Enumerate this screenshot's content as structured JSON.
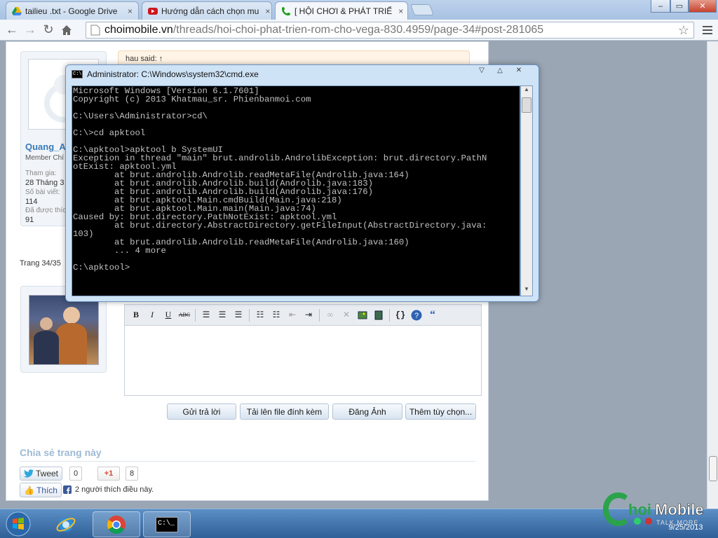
{
  "browser": {
    "tabs": [
      {
        "title": "tailieu .txt - Google Drive",
        "icon": "google-drive-icon"
      },
      {
        "title": "Hướng dẫn cách chọn mu",
        "icon": "youtube-icon"
      },
      {
        "title": "[ HỘI CHƠI & PHÁT TRIỂ",
        "icon": "phone-icon",
        "active": true
      }
    ],
    "close_glyph": "×",
    "window_buttons": [
      "–",
      "▭",
      "✕"
    ],
    "url_host": "choimobile.vn",
    "url_path": "/threads/hoi-choi-phat-trien-rom-cho-vega-830.4959/page-34#post-281065"
  },
  "forum": {
    "quote_header": "hau said: ↑",
    "user1": {
      "name": "Quang_A",
      "title": "Member Chí",
      "fields": [
        {
          "label": "Tham gia:",
          "value": "28 Tháng 3"
        },
        {
          "label": "Số bài viết:",
          "value": "114"
        },
        {
          "label": "Đã được thíc",
          "value": "91"
        }
      ]
    },
    "page_label": "Trang 34/35",
    "editor_tools": [
      "B",
      "I",
      "U",
      "ABC"
    ],
    "buttons": {
      "reply": "Gửi trả lời",
      "upload": "Tải lên file đính kèm",
      "post_image": "Đăng Ảnh",
      "more": "Thêm tùy chọn..."
    },
    "share": {
      "title": "Chia sẻ trang này",
      "tweet": "Tweet",
      "tweet_count": "0",
      "gplus": "+1",
      "gplus_count": "8",
      "like": "Thích",
      "like_text": "2 người thích điều này."
    }
  },
  "cmd": {
    "title": "Administrator: C:\\Windows\\system32\\cmd.exe",
    "icon_label": "C:\\",
    "lines": "Microsoft Windows [Version 6.1.7601]\nCopyright (c) 2013 Khatmau_sr. Phienbanmoi.com\n\nC:\\Users\\Administrator>cd\\\n\nC:\\>cd apktool\n\nC:\\apktool>apktool b SystemUI\nException in thread \"main\" brut.androlib.AndrolibException: brut.directory.PathN\notExist: apktool.yml\n        at brut.androlib.Androlib.readMetaFile(Androlib.java:164)\n        at brut.androlib.Androlib.build(Androlib.java:183)\n        at brut.androlib.Androlib.build(Androlib.java:176)\n        at brut.apktool.Main.cmdBuild(Main.java:218)\n        at brut.apktool.Main.main(Main.java:74)\nCaused by: brut.directory.PathNotExist: apktool.yml\n        at brut.directory.AbstractDirectory.getFileInput(AbstractDirectory.java:\n103)\n        at brut.androlib.Androlib.readMetaFile(Androlib.java:160)\n        ... 4 more\n\nC:\\apktool>"
  },
  "taskbar": {
    "cmd_label": "C:\\_",
    "date": "9/25/2013",
    "watermark": "ChoiMobile",
    "watermark_sub": "TALK MORE"
  },
  "colors": {
    "link": "#3a7ab8",
    "share_title": "#9dbad6",
    "quote_bg": "#fff4e5",
    "cmd_bg": "#000000",
    "cmd_fg": "#c0c0c0"
  }
}
